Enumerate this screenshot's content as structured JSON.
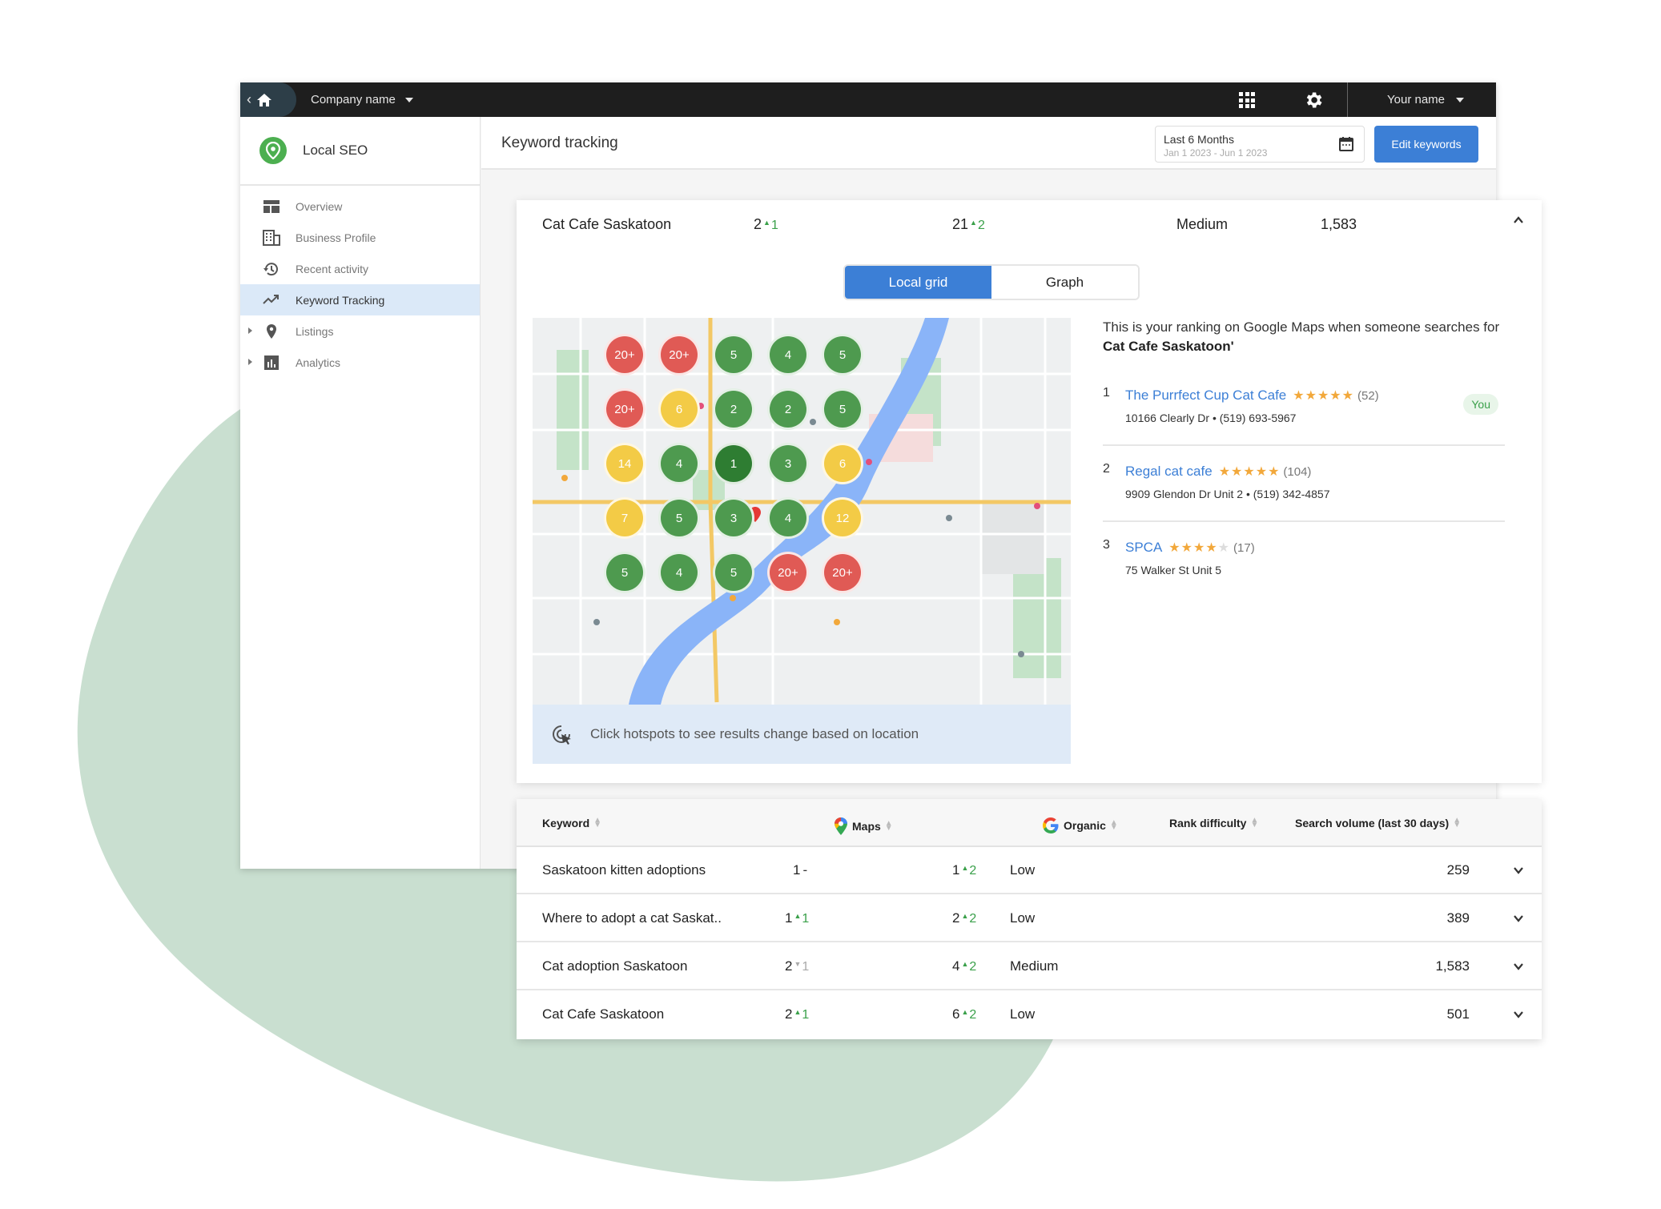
{
  "topbar": {
    "company_name": "Company name",
    "user_name": "Your name",
    "icons": [
      "back-icon",
      "home-icon",
      "apps-grid-icon",
      "gear-icon"
    ]
  },
  "sidebar": {
    "brand": "Local SEO",
    "items": [
      {
        "label": "Overview",
        "icon": "overview-icon",
        "active": false,
        "expandable": false
      },
      {
        "label": "Business Profile",
        "icon": "business-profile-icon",
        "active": false,
        "expandable": false
      },
      {
        "label": "Recent activity",
        "icon": "history-icon",
        "active": false,
        "expandable": false
      },
      {
        "label": "Keyword Tracking",
        "icon": "trending-icon",
        "active": true,
        "expandable": false
      },
      {
        "label": "Listings",
        "icon": "pin-icon",
        "active": false,
        "expandable": true
      },
      {
        "label": "Analytics",
        "icon": "bar-chart-icon",
        "active": false,
        "expandable": true
      }
    ]
  },
  "header": {
    "title": "Keyword tracking",
    "date_label": "Last 6 Months",
    "date_range": "Jan 1 2023 - Jun 1 2023",
    "edit_button": "Edit keywords"
  },
  "expanded": {
    "keyword": "Cat Cafe Saskatoon",
    "maps_rank": "2",
    "maps_change": "1",
    "organic_rank": "21",
    "organic_change": "2",
    "difficulty": "Medium",
    "volume": "1,583",
    "tabs": {
      "local_grid": "Local grid",
      "graph": "Graph",
      "active": "local_grid"
    },
    "hint": "Click hotspots to see results change based on location",
    "info_lead": "This is your ranking on Google Maps when someone searches for ",
    "info_keyword": "Cat Cafe Saskatoon'",
    "results": [
      {
        "rank": "1",
        "name": "The Purrfect Cup Cat Cafe",
        "stars": 5,
        "reviews": "(52)",
        "address": "10166 Clearly Dr • (519) 693-5967",
        "badge": "You"
      },
      {
        "rank": "2",
        "name": "Regal cat cafe",
        "stars": 5,
        "reviews": "(104)",
        "address": "9909 Glendon Dr Unit 2 • (519) 342-4857",
        "badge": ""
      },
      {
        "rank": "3",
        "name": "SPCA",
        "stars": 4,
        "reviews": "(17)",
        "address": "75 Walker St Unit 5",
        "badge": ""
      }
    ],
    "grid": [
      [
        "20+",
        "20+",
        "5",
        "4",
        "5"
      ],
      [
        "20+",
        "6",
        "2",
        "2",
        "5"
      ],
      [
        "14",
        "4",
        "1",
        "3",
        "6"
      ],
      [
        "7",
        "5",
        "3",
        "4",
        "12"
      ],
      [
        "5",
        "4",
        "5",
        "20+",
        "20+"
      ]
    ]
  },
  "colors": {
    "accent": "#3c7fd6",
    "rank_green": "#4e9a4f",
    "rank_green_top": "#2e7d32",
    "rank_yellow": "#f3cb46",
    "rank_red": "#e05a55",
    "up_green": "#3aa04a",
    "blob": "#c9dfd0"
  },
  "table": {
    "headers": {
      "keyword": "Keyword",
      "maps": "Maps",
      "organic": "Organic",
      "difficulty": "Rank difficulty",
      "volume": "Search volume (last 30 days)"
    },
    "rows": [
      {
        "keyword": "Saskatoon kitten adoptions",
        "maps_rank": "1",
        "maps_change": "-",
        "maps_dir": "none",
        "organic_rank": "1",
        "organic_change": "2",
        "organic_dir": "up",
        "difficulty": "Low",
        "volume": "259"
      },
      {
        "keyword": "Where to adopt a cat Saskat..",
        "maps_rank": "1",
        "maps_change": "1",
        "maps_dir": "up",
        "organic_rank": "2",
        "organic_change": "2",
        "organic_dir": "up",
        "difficulty": "Low",
        "volume": "389"
      },
      {
        "keyword": "Cat adoption Saskatoon",
        "maps_rank": "2",
        "maps_change": "1",
        "maps_dir": "down",
        "organic_rank": "4",
        "organic_change": "2",
        "organic_dir": "up",
        "difficulty": "Medium",
        "volume": "1,583"
      },
      {
        "keyword": "Cat Cafe Saskatoon",
        "maps_rank": "2",
        "maps_change": "1",
        "maps_dir": "up",
        "organic_rank": "6",
        "organic_change": "2",
        "organic_dir": "up",
        "difficulty": "Low",
        "volume": "501"
      }
    ]
  }
}
